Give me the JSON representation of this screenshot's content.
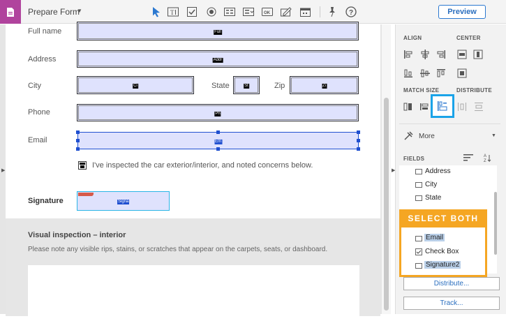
{
  "app": {
    "title": "Prepare Form",
    "preview_label": "Preview"
  },
  "toolbar": {
    "tools": [
      "cursor-tool",
      "text-field-tool",
      "checkbox-tool",
      "radio-tool",
      "list-box-tool",
      "dropdown-tool",
      "button-tool",
      "signature-tool",
      "date-tool",
      "pin-tool",
      "help-tool"
    ]
  },
  "form": {
    "full_name": {
      "label": "Full name",
      "tag": "Full"
    },
    "address": {
      "label": "Address",
      "tag": "Addr"
    },
    "city": {
      "label": "City",
      "tag": "Ci"
    },
    "state": {
      "label": "State",
      "tag": "St"
    },
    "zip": {
      "label": "Zip",
      "tag": "Zi"
    },
    "phone": {
      "label": "Phone",
      "tag": "Ph"
    },
    "email": {
      "label": "Email",
      "tag": "Em"
    },
    "checkbox_text": "I've inspected the car exterior/interior, and noted concerns below.",
    "signature": {
      "label": "Signature",
      "tag": "Signa"
    },
    "section2_title": "Visual inspection – interior",
    "section2_desc": "Please note any visible rips, stains, or scratches that appear on the carpets, seats, or dashboard."
  },
  "panel": {
    "align_title": "ALIGN",
    "center_title": "CENTER",
    "match_size_title": "MATCH SIZE",
    "distribute_title": "DISTRIBUTE",
    "more_label": "More",
    "fields_title": "FIELDS",
    "fields": [
      {
        "label": "Address",
        "selected": false
      },
      {
        "label": "City",
        "selected": false
      },
      {
        "label": "State",
        "selected": false
      },
      {
        "label": "Email",
        "selected": true
      },
      {
        "label": "Check Box",
        "selected": false
      },
      {
        "label": "Signature2",
        "selected": true
      }
    ],
    "callout": "SELECT BOTH",
    "distribute_button": "Distribute...",
    "track_button": "Track..."
  },
  "colors": {
    "accent": "#2b78d0",
    "highlight_orange": "#f5a623",
    "field_fill": "#dfe2fd",
    "app_icon": "#b0439d",
    "match_size_highlight": "#1aa3e8"
  }
}
